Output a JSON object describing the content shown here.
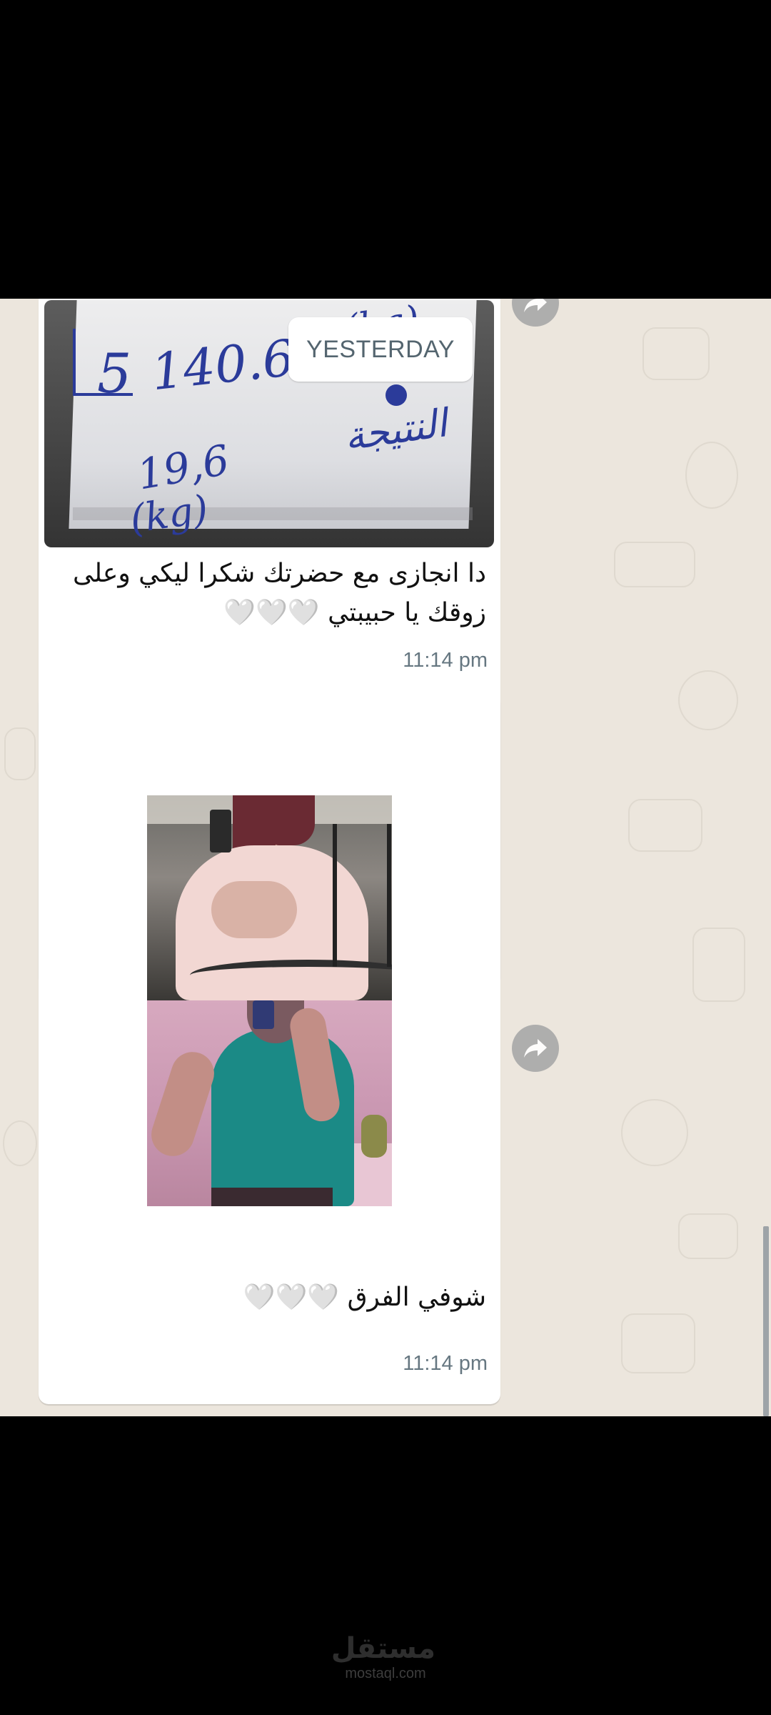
{
  "chat": {
    "date_separator": "YESTERDAY",
    "messages": [
      {
        "image": {
          "kind": "photo",
          "description_icon": "scale-paper-photo",
          "visible_text": {
            "line1": "140.6",
            "box_digit": "5",
            "unit_top": "(kg)",
            "label": "النتيجة",
            "result": "19,6",
            "unit_bottom": "(kg)"
          }
        },
        "text": "دا انجازى مع حضرتك شكرا ليكي وعلى زوقك يا حبيبتي 🤍🤍🤍",
        "time": "11:14 pm"
      },
      {
        "image": {
          "kind": "before-after-collage",
          "description_icon": "before-after-photo"
        },
        "text": "شوفي الفرق 🤍🤍🤍",
        "time": "11:14 pm"
      }
    ],
    "forward_icon": "forward-icon"
  },
  "watermark": {
    "arabic": "مستقل",
    "latin": "mostaql.com"
  },
  "colors": {
    "chat_background": "#ece6dd",
    "bubble": "#ffffff",
    "time_text": "#667781",
    "ink": "#2b3b9a"
  }
}
